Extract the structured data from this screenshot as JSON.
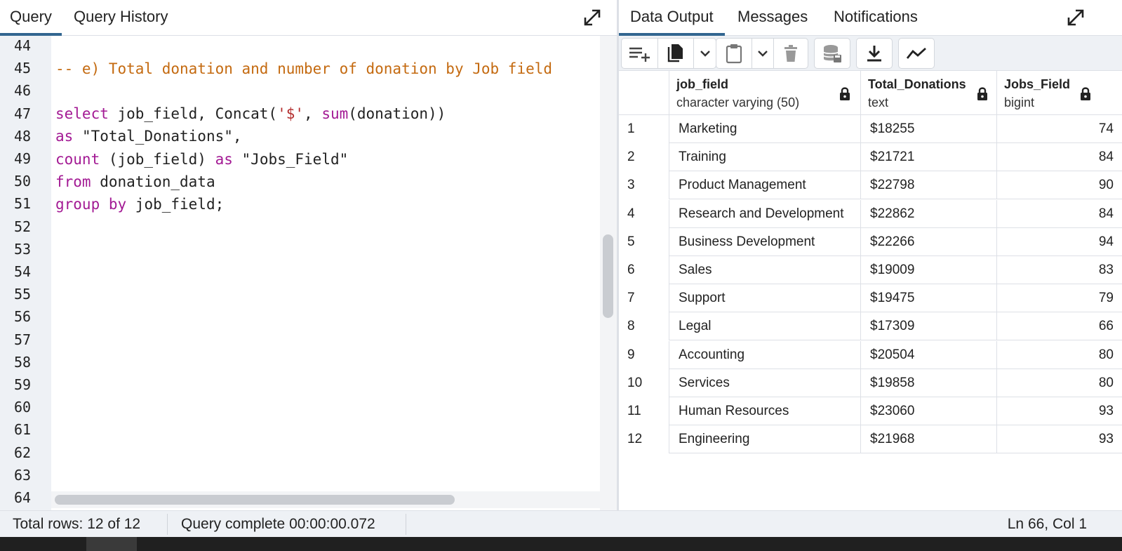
{
  "query_panel": {
    "tabs": [
      {
        "label": "Query",
        "active": true
      },
      {
        "label": "Query History",
        "active": false
      }
    ],
    "line_numbers": [
      "44",
      "45",
      "46",
      "47",
      "48",
      "49",
      "50",
      "51",
      "52",
      "53",
      "54",
      "55",
      "56",
      "57",
      "58",
      "59",
      "60",
      "61",
      "62",
      "63",
      "64"
    ],
    "code": {
      "l45": "-- e) Total donation and number of donation by Job field",
      "l47_kw1": "select",
      "l47_a": " job_field, Concat(",
      "l47_str": "'$'",
      "l47_b": ", ",
      "l47_kw2": "sum",
      "l47_c": "(donation))",
      "l48_kw": "as",
      "l48_a": " \"Total_Donations\",",
      "l49_kw1": "count",
      "l49_a": " (job_field) ",
      "l49_kw2": "as",
      "l49_b": " \"Jobs_Field\"",
      "l50_kw": "from",
      "l50_a": " donation_data",
      "l51_kw": "group by",
      "l51_a": " job_field;"
    }
  },
  "results_panel": {
    "tabs": [
      {
        "label": "Data Output",
        "active": true
      },
      {
        "label": "Messages",
        "active": false
      },
      {
        "label": "Notifications",
        "active": false
      }
    ],
    "toolbar_icons": [
      "add-row-icon",
      "copy-icon",
      "chevron-down-icon",
      "paste-icon",
      "chevron-down-icon",
      "delete-icon",
      "save-data-icon",
      "download-icon",
      "graph-visualiser-icon"
    ],
    "columns": [
      {
        "name": "job_field",
        "type": "character varying (50)"
      },
      {
        "name": "Total_Donations",
        "type": "text"
      },
      {
        "name": "Jobs_Field",
        "type": "bigint"
      }
    ],
    "rows": [
      {
        "n": "1",
        "job_field": "Marketing",
        "total": "$18255",
        "jobs": "74"
      },
      {
        "n": "2",
        "job_field": "Training",
        "total": "$21721",
        "jobs": "84"
      },
      {
        "n": "3",
        "job_field": "Product Management",
        "total": "$22798",
        "jobs": "90"
      },
      {
        "n": "4",
        "job_field": "Research and Development",
        "total": "$22862",
        "jobs": "84"
      },
      {
        "n": "5",
        "job_field": "Business Development",
        "total": "$22266",
        "jobs": "94"
      },
      {
        "n": "6",
        "job_field": "Sales",
        "total": "$19009",
        "jobs": "83"
      },
      {
        "n": "7",
        "job_field": "Support",
        "total": "$19475",
        "jobs": "79"
      },
      {
        "n": "8",
        "job_field": "Legal",
        "total": "$17309",
        "jobs": "66"
      },
      {
        "n": "9",
        "job_field": "Accounting",
        "total": "$20504",
        "jobs": "80"
      },
      {
        "n": "10",
        "job_field": "Services",
        "total": "$19858",
        "jobs": "80"
      },
      {
        "n": "11",
        "job_field": "Human Resources",
        "total": "$23060",
        "jobs": "93"
      },
      {
        "n": "12",
        "job_field": "Engineering",
        "total": "$21968",
        "jobs": "93"
      }
    ]
  },
  "status_bar": {
    "total_rows": "Total rows: 12 of 12",
    "query_status": "Query complete 00:00:00.072",
    "cursor": "Ln 66, Col 1"
  },
  "colors": {
    "accent": "#326690",
    "keyword": "#a31a94",
    "comment": "#c46a10",
    "string": "#b32d2d"
  }
}
